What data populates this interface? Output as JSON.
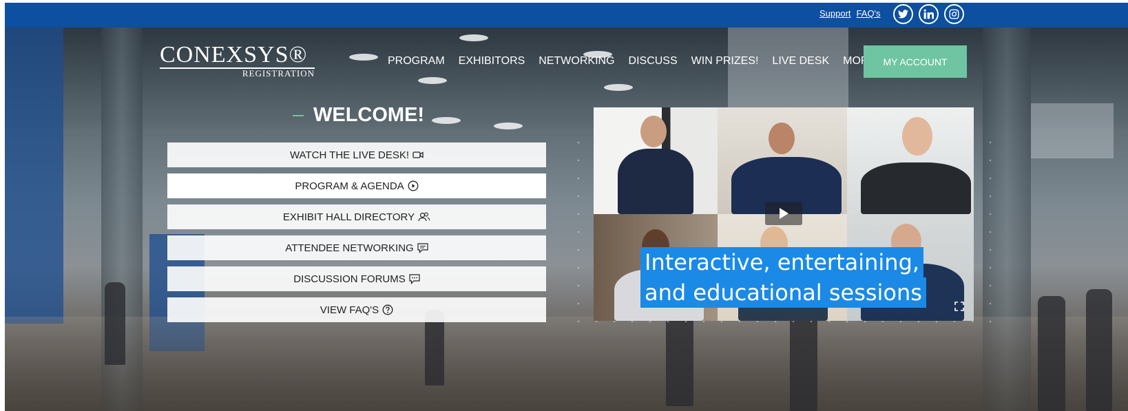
{
  "topbar": {
    "links": [
      "Support",
      "FAQ's"
    ],
    "socials": [
      {
        "icon": "twitter-icon"
      },
      {
        "icon": "linkedin-icon"
      },
      {
        "icon": "instagram-icon"
      }
    ]
  },
  "brand": {
    "logo_main": "CONEXSYS®",
    "logo_sub": "REGISTRATION"
  },
  "nav": {
    "items": [
      "PROGRAM",
      "EXHIBITORS",
      "NETWORKING",
      "DISCUSS",
      "WIN PRIZES!",
      "LIVE DESK",
      "MORE"
    ],
    "account_label": "MY ACCOUNT"
  },
  "welcome": {
    "title": "WELCOME!"
  },
  "menu": {
    "items": [
      {
        "label": "WATCH THE LIVE DESK!",
        "icon": "video-camera-icon"
      },
      {
        "label": "PROGRAM & AGENDA",
        "icon": "play-circle-icon"
      },
      {
        "label": "EXHIBIT HALL DIRECTORY",
        "icon": "people-icon"
      },
      {
        "label": "ATTENDEE NETWORKING",
        "icon": "chat-icon"
      },
      {
        "label": "DISCUSSION FORUMS",
        "icon": "chat-dots-icon"
      },
      {
        "label": "VIEW FAQ'S",
        "icon": "question-circle-icon"
      }
    ]
  },
  "video": {
    "caption_line1": "Interactive, entertaining,",
    "caption_line2": "and educational sessions"
  },
  "colors": {
    "topbar": "#0d4fa0",
    "accent": "#6fc5a2",
    "caption_bg": "#1a8ae6"
  }
}
